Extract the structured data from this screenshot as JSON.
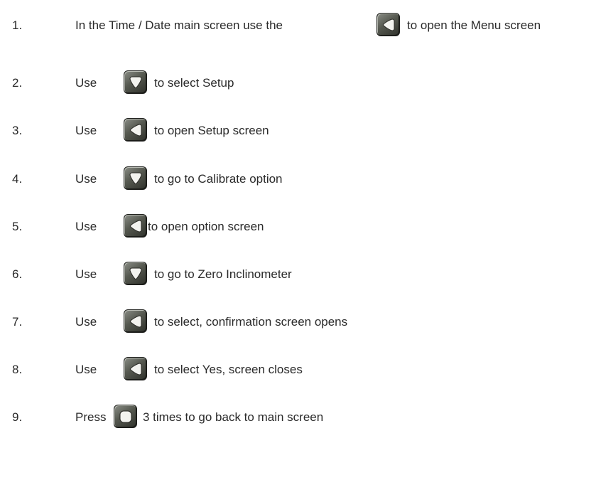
{
  "steps": [
    {
      "num": "1.",
      "lead": "In the Time / Date main screen use the",
      "icon": "left-arrow-button-icon",
      "rest": "to open the Menu screen"
    },
    {
      "num": "2.",
      "lead": "Use",
      "icon": "down-arrow-button-icon",
      "rest": "to select Setup"
    },
    {
      "num": "3.",
      "lead": "Use",
      "icon": "left-arrow-button-icon",
      "rest": "to open Setup screen"
    },
    {
      "num": "4.",
      "lead": "Use",
      "icon": "down-arrow-button-icon",
      "rest": "to  go to Calibrate option"
    },
    {
      "num": "5.",
      "lead": "Use",
      "icon": "left-arrow-button-icon",
      "rest": "to open option screen"
    },
    {
      "num": "6.",
      "lead": "Use",
      "icon": "down-arrow-button-icon",
      "rest": "to go to Zero Inclinometer"
    },
    {
      "num": "7.",
      "lead": "Use",
      "icon": "left-arrow-button-icon",
      "rest": "to select, confirmation screen opens"
    },
    {
      "num": "8.",
      "lead": "Use",
      "icon": "left-arrow-button-icon",
      "rest": "to select Yes, screen closes"
    },
    {
      "num": "9.",
      "lead": "Press",
      "icon": "square-button-icon",
      "rest": "3 times to go back to main screen"
    }
  ]
}
